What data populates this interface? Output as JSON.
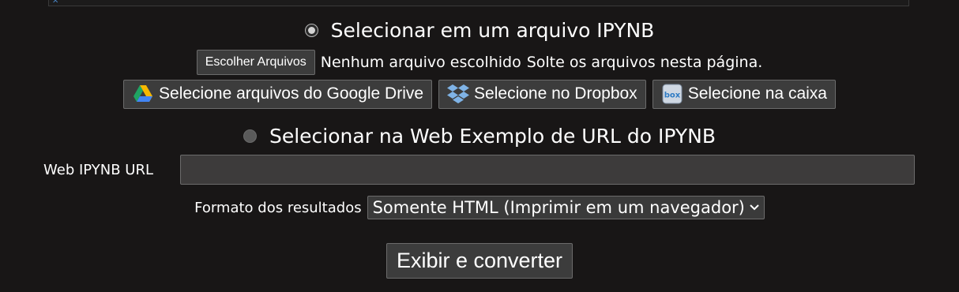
{
  "upload": {
    "radio_label": "Selecionar em um arquivo IPYNB",
    "choose_files_label": "Escolher Arquivos",
    "no_file_label": "Nenhum arquivo escolhido",
    "drop_hint": "Solte os arquivos nesta página."
  },
  "cloud": {
    "google_drive_label": "Selecione arquivos do Google Drive",
    "dropbox_label": "Selecione no Dropbox",
    "box_label": "Selecione na caixa",
    "box_icon_text": "box"
  },
  "web": {
    "radio_label": "Selecionar na Web Exemplo de URL do IPYNB",
    "url_label": "Web IPYNB URL",
    "url_value": ""
  },
  "output": {
    "format_label": "Formato dos resultados",
    "format_selected": "Somente HTML (Imprimir em um navegador)"
  },
  "submit": {
    "label": "Exibir e converter"
  },
  "colors": {
    "background": "#181616",
    "button_bg": "#3c3c3c",
    "drive_yellow": "#F6B800",
    "drive_green": "#1FA463",
    "drive_blue": "#4285F4",
    "dropbox_blue": "#7FB3E6",
    "box_blue": "#2E7BC4"
  }
}
